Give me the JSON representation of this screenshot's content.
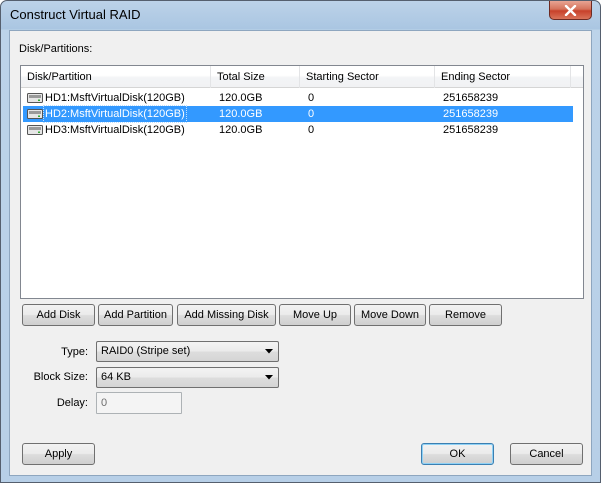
{
  "window": {
    "title": "Construct Virtual RAID"
  },
  "section": {
    "label": "Disk/Partitions:"
  },
  "table": {
    "columns": [
      "Disk/Partition",
      "Total Size",
      "Starting Sector",
      "Ending Sector"
    ],
    "rows": [
      {
        "name": "HD1:MsftVirtualDisk(120GB)",
        "size": "120.0GB",
        "start": "0",
        "end": "251658239",
        "selected": false
      },
      {
        "name": "HD2:MsftVirtualDisk(120GB)",
        "size": "120.0GB",
        "start": "0",
        "end": "251658239",
        "selected": true
      },
      {
        "name": "HD3:MsftVirtualDisk(120GB)",
        "size": "120.0GB",
        "start": "0",
        "end": "251658239",
        "selected": false
      }
    ]
  },
  "actions": {
    "add_disk": "Add Disk",
    "add_partition": "Add Partition",
    "add_missing_disk": "Add Missing Disk",
    "move_up": "Move Up",
    "move_down": "Move Down",
    "remove": "Remove"
  },
  "form": {
    "type_label": "Type:",
    "type_value": "RAID0 (Stripe set)",
    "block_size_label": "Block Size:",
    "block_size_value": "64 KB",
    "delay_label": "Delay:",
    "delay_value": "0"
  },
  "footer": {
    "apply": "Apply",
    "ok": "OK",
    "cancel": "Cancel"
  },
  "icons": {
    "close": "close-icon",
    "disk": "disk-icon",
    "dropdown": "chevron-down-icon"
  },
  "colors": {
    "selection": "#3399ff",
    "close_button": "#c8412a"
  }
}
